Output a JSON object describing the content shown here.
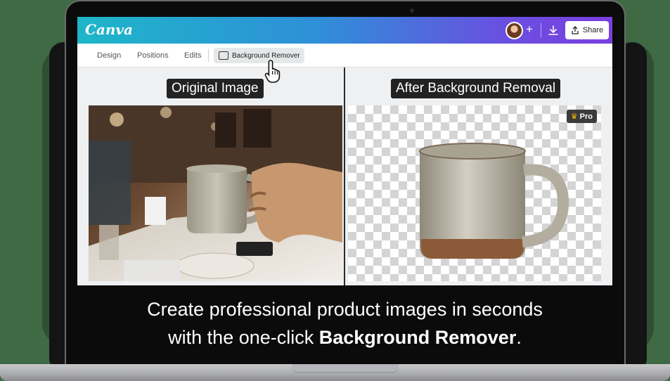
{
  "app": {
    "logo": "Canva"
  },
  "topbar": {
    "share_label": "Share",
    "plus_glyph": "+"
  },
  "toolbar": {
    "items": [
      "Design",
      "Positions",
      "Edits"
    ],
    "active_item": "Background Remover"
  },
  "panels": {
    "left_label": "Original Image",
    "right_label": "After Background Removal",
    "badge": "Pro",
    "badge_icon": "crown-icon"
  },
  "caption": {
    "line1": "Create professional product images in seconds",
    "line2_prefix": "with the one-click ",
    "line2_bold": "Background Remover",
    "line2_suffix": "."
  },
  "colors": {
    "topbar_start": "#1db6c9",
    "topbar_end": "#7b3fe0",
    "background": "#3f6a44"
  }
}
